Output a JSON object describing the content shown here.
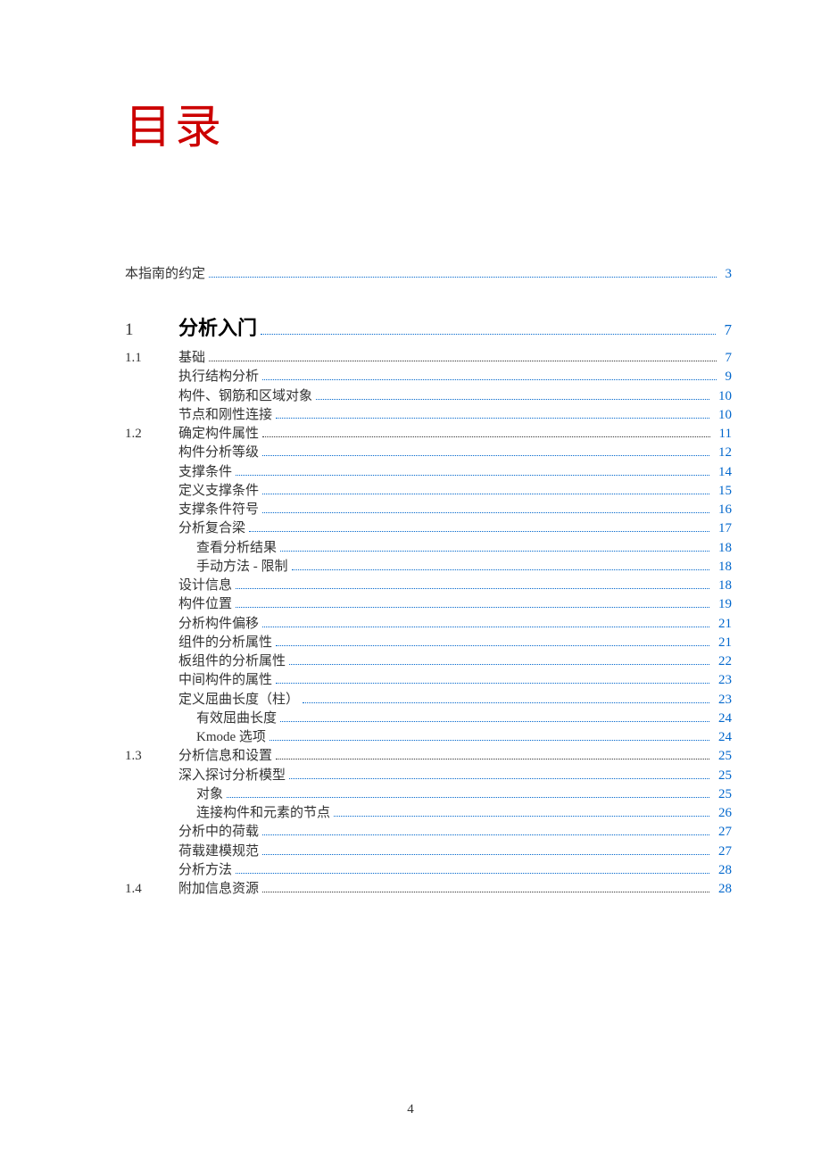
{
  "title": "目录",
  "page_number": "4",
  "top_entry": {
    "label": "本指南的约定",
    "page": "3"
  },
  "chapter": {
    "num": "1",
    "label": "分析入门",
    "page": "7"
  },
  "sections": [
    {
      "num": "1.1",
      "heading": {
        "label": "基础",
        "page": "7"
      },
      "items": [
        {
          "label": "执行结构分析",
          "page": "9",
          "indent": 1
        },
        {
          "label": "构件、钢筋和区域对象",
          "page": "10",
          "indent": 1
        },
        {
          "label": "节点和刚性连接",
          "page": "10",
          "indent": 1
        }
      ]
    },
    {
      "num": "1.2",
      "heading": {
        "label": "确定构件属性",
        "page": "11"
      },
      "items": [
        {
          "label": "构件分析等级",
          "page": "12",
          "indent": 1
        },
        {
          "label": "支撑条件",
          "page": "14",
          "indent": 1
        },
        {
          "label": "定义支撑条件",
          "page": "15",
          "indent": 1
        },
        {
          "label": "支撑条件符号",
          "page": "16",
          "indent": 1
        },
        {
          "label": "分析复合梁",
          "page": "17",
          "indent": 1
        },
        {
          "label": "查看分析结果",
          "page": "18",
          "indent": 2
        },
        {
          "label": "手动方法 - 限制",
          "page": "18",
          "indent": 2
        },
        {
          "label": "设计信息",
          "page": "18",
          "indent": 1
        },
        {
          "label": "构件位置",
          "page": "19",
          "indent": 1
        },
        {
          "label": "分析构件偏移",
          "page": "21",
          "indent": 1
        },
        {
          "label": "组件的分析属性",
          "page": "21",
          "indent": 1
        },
        {
          "label": "板组件的分析属性",
          "page": "22",
          "indent": 1
        },
        {
          "label": "中间构件的属性",
          "page": "23",
          "indent": 1
        },
        {
          "label": "定义屈曲长度（柱）",
          "page": "23",
          "indent": 1
        },
        {
          "label": "有效屈曲长度",
          "page": "24",
          "indent": 2
        },
        {
          "label": "Kmode 选项",
          "page": "24",
          "indent": 2
        }
      ]
    },
    {
      "num": "1.3",
      "heading": {
        "label": "分析信息和设置",
        "page": "25"
      },
      "items": [
        {
          "label": "深入探讨分析模型",
          "page": "25",
          "indent": 1
        },
        {
          "label": "对象",
          "page": "25",
          "indent": 2
        },
        {
          "label": "连接构件和元素的节点",
          "page": "26",
          "indent": 2
        },
        {
          "label": "分析中的荷载",
          "page": "27",
          "indent": 1
        },
        {
          "label": "荷载建模规范",
          "page": "27",
          "indent": 1
        },
        {
          "label": "分析方法",
          "page": "28",
          "indent": 1
        }
      ]
    },
    {
      "num": "1.4",
      "heading": {
        "label": "附加信息资源",
        "page": "28"
      },
      "items": []
    }
  ]
}
